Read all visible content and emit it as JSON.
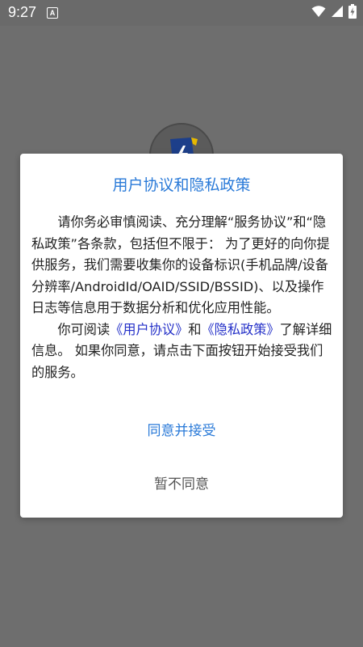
{
  "status_bar": {
    "time": "9:27",
    "notification_glyph": "A",
    "icons": [
      "wifi-icon",
      "signal-icon",
      "battery-icon"
    ]
  },
  "dialog": {
    "title": "用户协议和隐私政策",
    "paragraph1": "请你务必审慎阅读、充分理解“服务协议”和“隐私政策”各条款，包括但不限于： 为了更好的向你提供服务，我们需要收集你的设备标识(手机品牌/设备分辨率/AndroidId/OAID/SSID/BSSID)、以及操作日志等信息用于数据分析和优化应用性能。",
    "paragraph2_prefix": "你可阅读",
    "user_agreement_link": "《用户协议》",
    "paragraph2_and": "和",
    "privacy_policy_link": "《隐私政策》",
    "paragraph2_suffix": "了解详细信息。 如果你同意，请点击下面按钮开始接受我们的服务。",
    "agree_label": "同意并接受",
    "disagree_label": "暂不同意"
  },
  "colors": {
    "accent": "#2a7ad8",
    "link": "#2430c8",
    "overlay": "#6e6e6e"
  }
}
